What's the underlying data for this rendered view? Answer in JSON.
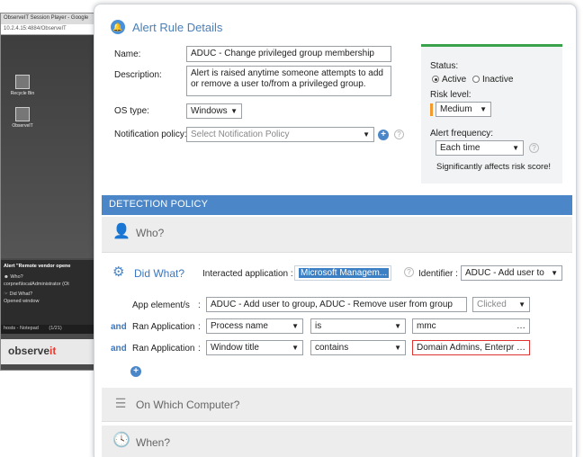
{
  "bg_window": {
    "title": "ObserveIT Session Player - Google",
    "url": "10.2.4.15:4884/ObserveIT",
    "desktop_icons": [
      "Recycle Bin",
      "ObserveIT"
    ],
    "alert_title": "Alert \"Remote vendor opene",
    "alert_who_label": "Who?",
    "alert_who_value": "corpnet\\localAdministrator (Ot",
    "alert_did_label": "Did What?",
    "alert_did_value": "Opened window",
    "status_text": "hosts - Notepad",
    "status_count": "(1/21)",
    "brand_main": "observe",
    "brand_accent": "it"
  },
  "header": {
    "title": "Alert Rule Details"
  },
  "form": {
    "name_label": "Name:",
    "name_value": "ADUC - Change privileged group membership",
    "description_label": "Description:",
    "description_value": "Alert is raised anytime someone attempts to add or remove a user to/from a privileged group.",
    "os_label": "OS type:",
    "os_value": "Windows",
    "notification_label": "Notification policy:",
    "notification_placeholder": "Select Notification Policy"
  },
  "side": {
    "status_label": "Status:",
    "status_options": [
      "Active",
      "Inactive"
    ],
    "status_selected": "Active",
    "risk_label": "Risk level:",
    "risk_value": "Medium",
    "frequency_label": "Alert frequency:",
    "frequency_value": "Each time",
    "note": "Significantly affects risk score!"
  },
  "detection": {
    "bar_title": "DETECTION POLICY",
    "who_title": "Who?",
    "did_title": "Did What?",
    "interacted_label": "Interacted application :",
    "interacted_value": "Microsoft Managem...",
    "identifier_label": "Identifier :",
    "identifier_value": "ADUC - Add user to",
    "app_elements_label": "App element/s",
    "app_elements_value": "ADUC - Add user to group, ADUC - Remove user from group",
    "app_elements_mode": "Clicked",
    "rows": [
      {
        "conj": "and",
        "label": "Ran Application",
        "field": "Process name",
        "op": "is",
        "value": "mmc"
      },
      {
        "conj": "and",
        "label": "Ran Application",
        "field": "Window title",
        "op": "contains",
        "value": "Domain Admins, Enterpri"
      }
    ],
    "computer_title": "On Which Computer?",
    "when_title": "When?"
  },
  "colors": {
    "accent": "#4a86c8",
    "status_green": "#3aa24a",
    "risk_orange": "#f29a2e",
    "invalid_red": "#d33333"
  }
}
